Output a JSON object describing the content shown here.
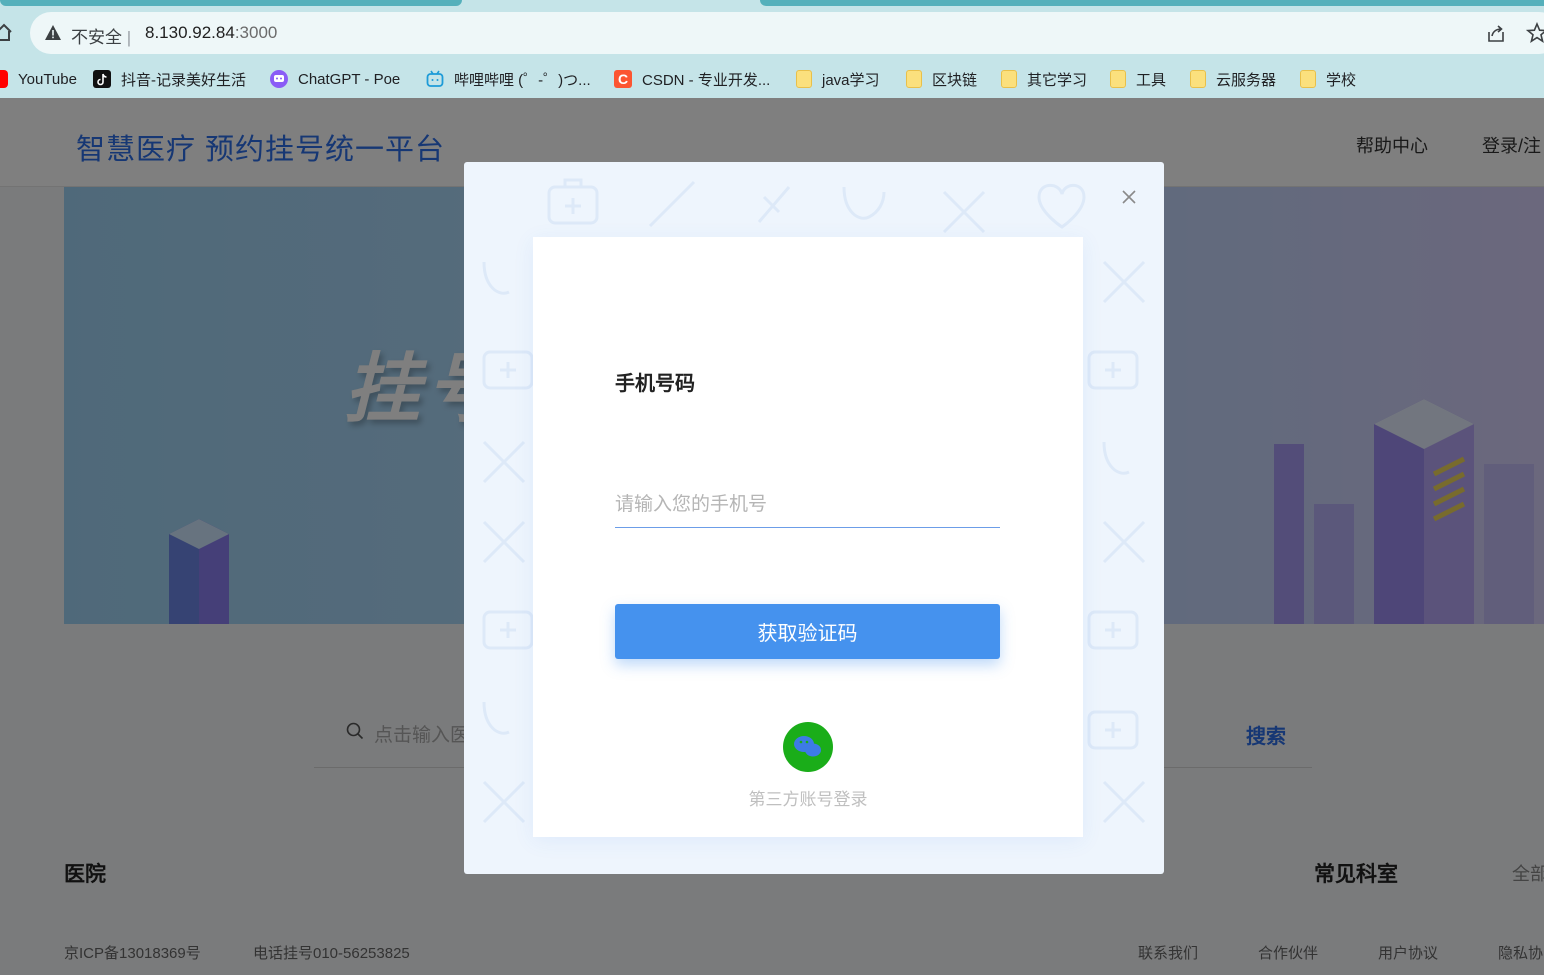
{
  "browser": {
    "insecure_label": "不安全",
    "url_host": "8.130.92.84",
    "url_port": ":3000",
    "bookmarks": [
      {
        "label": "YouTube",
        "icon": "youtube-icon"
      },
      {
        "label": "抖音-记录美好生活",
        "icon": "tiktok-icon"
      },
      {
        "label": "ChatGPT - Poe",
        "icon": "poe-icon"
      },
      {
        "label": "哔哩哔哩 (゜-゜)つ...",
        "icon": "bilibili-icon"
      },
      {
        "label": "CSDN - 专业开发...",
        "icon": "csdn-icon"
      },
      {
        "label": "java学习",
        "icon": "folder-icon"
      },
      {
        "label": "区块链",
        "icon": "folder-icon"
      },
      {
        "label": "其它学习",
        "icon": "folder-icon"
      },
      {
        "label": "工具",
        "icon": "folder-icon"
      },
      {
        "label": "云服务器",
        "icon": "folder-icon"
      },
      {
        "label": "学校",
        "icon": "folder-icon"
      }
    ]
  },
  "header": {
    "title": "智慧医疗 预约挂号统一平台",
    "help": "帮助中心",
    "login": "登录/注"
  },
  "banner": {
    "text": "挂号"
  },
  "search": {
    "placeholder": "点击输入医",
    "button": "搜索"
  },
  "sections": {
    "hospital": "医院",
    "department": "常见科室",
    "all": "全部"
  },
  "footer": {
    "icp": "京ICP备13018369号",
    "phone": "电话挂号010-56253825",
    "contact": "联系我们",
    "partners": "合作伙伴",
    "agreement": "用户协议",
    "privacy": "隐私协"
  },
  "login_dialog": {
    "phone_label": "手机号码",
    "phone_placeholder": "请输入您的手机号",
    "phone_value": "",
    "get_code_button": "获取验证码",
    "third_party_label": "第三方账号登录"
  },
  "colors": {
    "brand_blue": "#2d6fe8",
    "button_blue": "#4592ee",
    "wechat_green": "#1aad19",
    "browser_teal": "#c5e4e8"
  }
}
